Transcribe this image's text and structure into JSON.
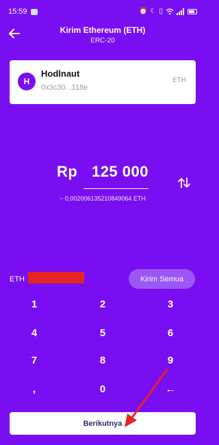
{
  "statusbar": {
    "time": "15:59",
    "right_icons": [
      "alarm-icon",
      "moon-icon",
      "vibrate-icon",
      "wifi-icon",
      "signal-icon",
      "battery-icon"
    ]
  },
  "header": {
    "title": "Kirim Ethereum (ETH)",
    "subtitle": "ERC-20",
    "back_icon": "arrow-left-icon"
  },
  "recipient": {
    "avatar_letter": "H",
    "name": "Hodlnaut",
    "address": "0x3c30...118e",
    "ticker": "ETH"
  },
  "amount": {
    "currency": "Rp",
    "value": "125 000",
    "eth_equivalent": "~ 0,002006135210849064 ETH",
    "swap_icon": "swap-arrows-icon"
  },
  "balance": {
    "label": "ETH",
    "send_all_label": "Kirim Semua"
  },
  "keypad": {
    "keys": [
      "1",
      "2",
      "3",
      "4",
      "5",
      "6",
      "7",
      "8",
      "9",
      ",",
      "0",
      "←"
    ]
  },
  "next_button": {
    "label": "Berikutnya"
  },
  "colors": {
    "background": "#7a0ef2",
    "annotation": "#e52424",
    "button_text": "#2e2a6e"
  }
}
